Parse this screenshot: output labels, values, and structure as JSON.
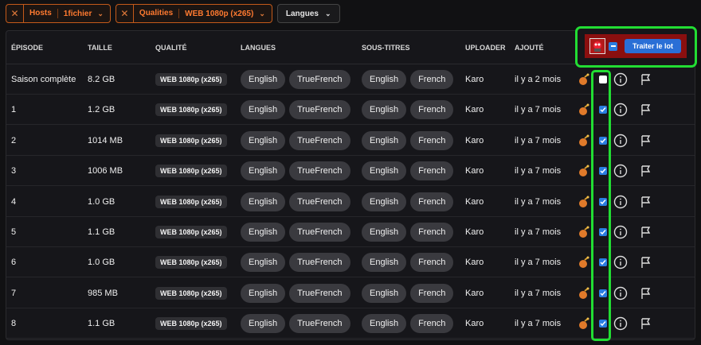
{
  "filters": {
    "hosts": {
      "name": "Hosts",
      "value": "1fichier"
    },
    "qualities": {
      "name": "Qualities",
      "value": "WEB 1080p (x265)"
    },
    "langues": {
      "label": "Langues"
    }
  },
  "table": {
    "headers": {
      "episode": "ÉPISODE",
      "taille": "TAILLE",
      "qualite": "QUALITÉ",
      "langues": "LANGUES",
      "sous_titres": "SOUS-TITRES",
      "uploader": "UPLOADER",
      "ajoute": "AJOUTÉ"
    },
    "batch_button": "Traiter le lot",
    "rows": [
      {
        "episode": "Saison complète",
        "taille": "8.2 GB",
        "qualite": "WEB 1080p (x265)",
        "langues": [
          "English",
          "TrueFrench"
        ],
        "sous_titres": [
          "English",
          "French"
        ],
        "uploader": "Karo",
        "ajoute": "il y a 2 mois",
        "checked": false
      },
      {
        "episode": "1",
        "taille": "1.2 GB",
        "qualite": "WEB 1080p (x265)",
        "langues": [
          "English",
          "TrueFrench"
        ],
        "sous_titres": [
          "English",
          "French"
        ],
        "uploader": "Karo",
        "ajoute": "il y a 7 mois",
        "checked": true
      },
      {
        "episode": "2",
        "taille": "1014 MB",
        "qualite": "WEB 1080p (x265)",
        "langues": [
          "English",
          "TrueFrench"
        ],
        "sous_titres": [
          "English",
          "French"
        ],
        "uploader": "Karo",
        "ajoute": "il y a 7 mois",
        "checked": true
      },
      {
        "episode": "3",
        "taille": "1006 MB",
        "qualite": "WEB 1080p (x265)",
        "langues": [
          "English",
          "TrueFrench"
        ],
        "sous_titres": [
          "English",
          "French"
        ],
        "uploader": "Karo",
        "ajoute": "il y a 7 mois",
        "checked": true
      },
      {
        "episode": "4",
        "taille": "1.0 GB",
        "qualite": "WEB 1080p (x265)",
        "langues": [
          "English",
          "TrueFrench"
        ],
        "sous_titres": [
          "English",
          "French"
        ],
        "uploader": "Karo",
        "ajoute": "il y a 7 mois",
        "checked": true
      },
      {
        "episode": "5",
        "taille": "1.1 GB",
        "qualite": "WEB 1080p (x265)",
        "langues": [
          "English",
          "TrueFrench"
        ],
        "sous_titres": [
          "English",
          "French"
        ],
        "uploader": "Karo",
        "ajoute": "il y a 7 mois",
        "checked": true
      },
      {
        "episode": "6",
        "taille": "1.0 GB",
        "qualite": "WEB 1080p (x265)",
        "langues": [
          "English",
          "TrueFrench"
        ],
        "sous_titres": [
          "English",
          "French"
        ],
        "uploader": "Karo",
        "ajoute": "il y a 7 mois",
        "checked": true
      },
      {
        "episode": "7",
        "taille": "985 MB",
        "qualite": "WEB 1080p (x265)",
        "langues": [
          "English",
          "TrueFrench"
        ],
        "sous_titres": [
          "English",
          "French"
        ],
        "uploader": "Karo",
        "ajoute": "il y a 7 mois",
        "checked": true
      },
      {
        "episode": "8",
        "taille": "1.1 GB",
        "qualite": "WEB 1080p (x265)",
        "langues": [
          "English",
          "TrueFrench"
        ],
        "sous_titres": [
          "English",
          "French"
        ],
        "uploader": "Karo",
        "ajoute": "il y a 7 mois",
        "checked": true
      }
    ],
    "row_icons": [
      "debrid-icon",
      "select-checkbox",
      "info-icon",
      "report-flag-icon"
    ]
  },
  "colors": {
    "accent_orange": "#ff7a30",
    "checkbox_blue": "#2a7de1",
    "highlight_green": "#22dd33",
    "batch_bg": "#8a0f0f"
  }
}
